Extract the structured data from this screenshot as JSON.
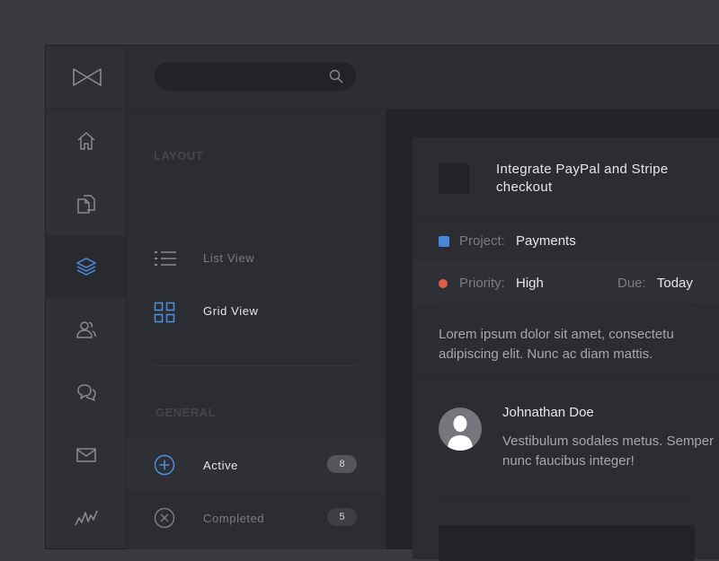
{
  "search": {
    "value": "",
    "placeholder": ""
  },
  "rail": {
    "items": [
      {
        "icon": "home-icon",
        "active": false
      },
      {
        "icon": "documents-icon",
        "active": false
      },
      {
        "icon": "layers-icon",
        "active": true
      },
      {
        "icon": "users-icon",
        "active": false
      },
      {
        "icon": "chat-icon",
        "active": false
      },
      {
        "icon": "mail-icon",
        "active": false
      },
      {
        "icon": "activity-icon",
        "active": false
      }
    ]
  },
  "panel": {
    "layout_title": "LAYOUT",
    "views": [
      {
        "label": "List View",
        "icon": "list-icon",
        "active": false
      },
      {
        "label": "Grid View",
        "icon": "grid-icon",
        "active": true
      }
    ],
    "general_title": "GENERAL",
    "statuses": [
      {
        "label": "Active",
        "count": "8",
        "icon": "plus-circle-icon",
        "active": true
      },
      {
        "label": "Completed",
        "count": "5",
        "icon": "x-circle-icon",
        "active": false
      }
    ]
  },
  "task": {
    "title": "Integrate PayPal and Stripe checkout",
    "project_label": "Project:",
    "project_value": "Payments",
    "priority_label": "Priority:",
    "priority_value": "High",
    "due_label": "Due:",
    "due_value": "Today",
    "description": "Lorem ipsum dolor sit amet, consectetu adipiscing elit. Nunc ac diam mattis.",
    "comment": {
      "author": "Johnathan Doe",
      "text": "Vestibulum sodales metus. Semper nunc faucibus integer!"
    }
  },
  "colors": {
    "accent": "#4a90e2",
    "project_dot": "#4a86d8",
    "priority_dot": "#e25c4a",
    "active_text": "#e6e7ea",
    "inactive_text": "#7a7b80"
  }
}
